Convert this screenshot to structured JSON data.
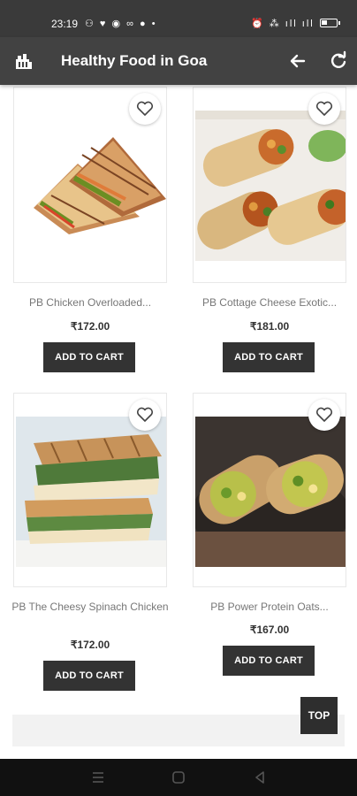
{
  "status_bar": {
    "time": "23:19",
    "left_icons": "⚇ ♥ ◉ ∞ ● •",
    "right_icons": "⏰ ⁂ ıll ıll"
  },
  "app_bar": {
    "title": "Healthy Food in Goa"
  },
  "products": [
    {
      "name": "PB Chicken Overloaded...",
      "price": "₹172.00",
      "cart_label": "ADD TO CART"
    },
    {
      "name": "PB Cottage Cheese Exotic...",
      "price": "₹181.00",
      "cart_label": "ADD TO CART"
    },
    {
      "name": "PB The Cheesy Spinach Chicken",
      "price": "₹172.00",
      "cart_label": "ADD TO CART"
    },
    {
      "name": "PB Power Protein Oats...",
      "price": "₹167.00",
      "cart_label": "ADD TO CART"
    }
  ],
  "top_button": {
    "label": "TOP"
  },
  "colors": {
    "app_bar": "#424242",
    "button": "#333333",
    "status_bar": "#3a3a3a"
  }
}
